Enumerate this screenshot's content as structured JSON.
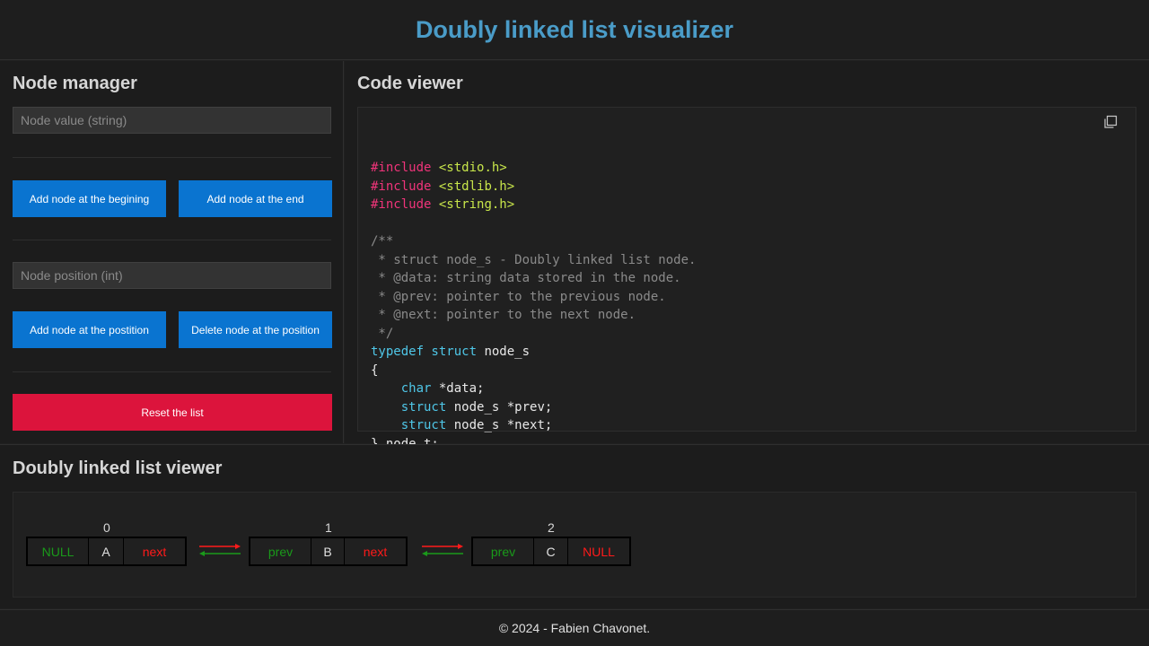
{
  "header": {
    "title": "Doubly linked list visualizer"
  },
  "manager": {
    "title": "Node manager",
    "value_placeholder": "Node value (string)",
    "add_begin_label": "Add node at the begining",
    "add_end_label": "Add node at the end",
    "position_placeholder": "Node position (int)",
    "add_position_label": "Add node at the postition",
    "delete_position_label": "Delete node at the position",
    "reset_label": "Reset the list"
  },
  "code": {
    "title": "Code viewer",
    "copy_icon": "copy-icon",
    "lines": [
      "#include <stdio.h>",
      "#include <stdlib.h>",
      "#include <string.h>",
      "",
      "/**",
      " * struct node_s - Doubly linked list node.",
      " * @data: string data stored in the node.",
      " * @prev: pointer to the previous node.",
      " * @next: pointer to the next node.",
      " */",
      "typedef struct node_s",
      "{",
      "    char *data;",
      "    struct node_s *prev;",
      "    struct node_s *next;",
      "} node_t;"
    ]
  },
  "viewer": {
    "title": "Doubly linked list viewer",
    "nodes": [
      {
        "index": "0",
        "prev": "NULL",
        "value": "A",
        "next": "next"
      },
      {
        "index": "1",
        "prev": "prev",
        "value": "B",
        "next": "next"
      },
      {
        "index": "2",
        "prev": "prev",
        "value": "C",
        "next": "NULL"
      }
    ]
  },
  "footer": {
    "text": "© 2024 - Fabien Chavonet."
  },
  "colors": {
    "accent": "#4a9cc8",
    "button_blue": "#0a74d0",
    "button_red": "#dc143c",
    "link_prev": "#1a9a1a",
    "link_next": "#ff1a1a"
  }
}
